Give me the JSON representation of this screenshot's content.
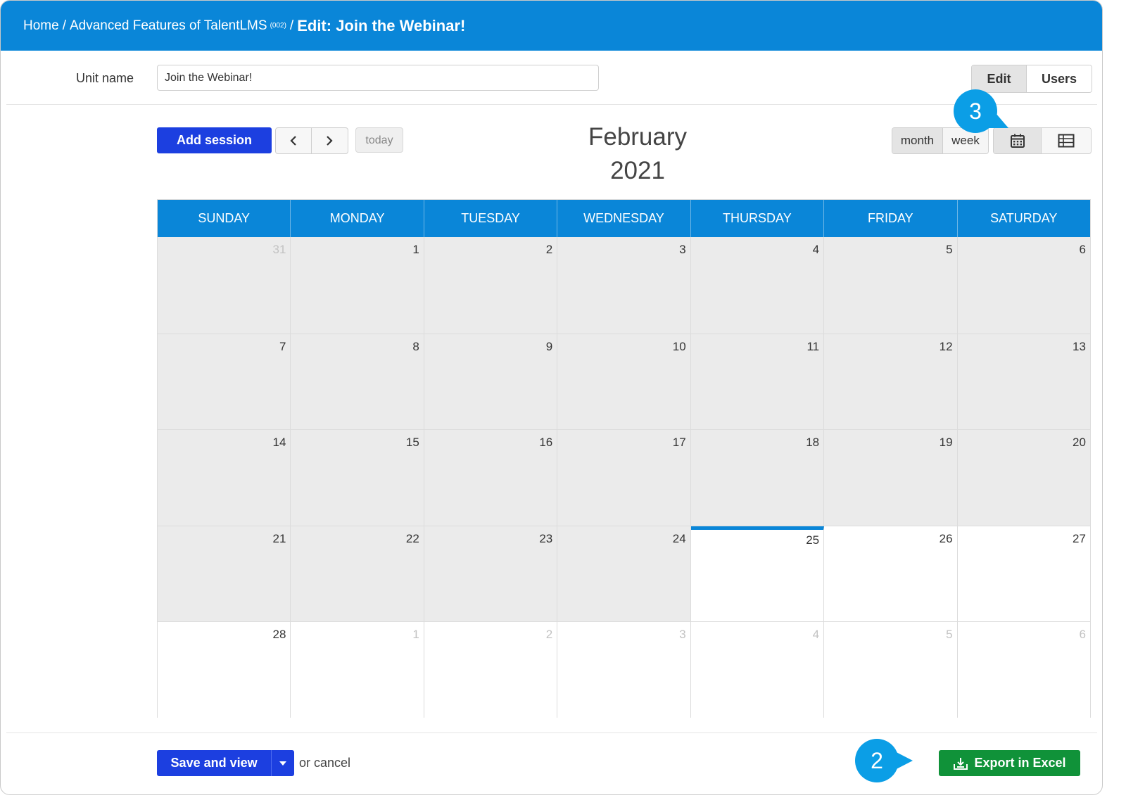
{
  "breadcrumb": {
    "home": "Home",
    "course": "Advanced Features of TalentLMS",
    "course_code": "(002)",
    "current": "Edit: Join the Webinar!"
  },
  "unit": {
    "label": "Unit name",
    "value": "Join the Webinar!"
  },
  "tabs": {
    "edit": "Edit",
    "users": "Users",
    "active": "Edit"
  },
  "toolbar": {
    "add_session": "Add session",
    "today": "today",
    "title_month": "February",
    "title_year": "2021",
    "view_month": "month",
    "view_week": "week",
    "active_view": "month",
    "calendar_view_icon": "calendar-icon",
    "list_view_icon": "table-icon"
  },
  "calendar": {
    "weekdays": [
      "SUNDAY",
      "MONDAY",
      "TUESDAY",
      "WEDNESDAY",
      "THURSDAY",
      "FRIDAY",
      "SATURDAY"
    ],
    "weeks": [
      [
        "31",
        "1",
        "2",
        "3",
        "4",
        "5",
        "6"
      ],
      [
        "7",
        "8",
        "9",
        "10",
        "11",
        "12",
        "13"
      ],
      [
        "14",
        "15",
        "16",
        "17",
        "18",
        "19",
        "20"
      ],
      [
        "21",
        "22",
        "23",
        "24",
        "25",
        "26",
        "27"
      ],
      [
        "28",
        "1",
        "2",
        "3",
        "4",
        "5",
        "6"
      ]
    ],
    "today": "25",
    "header_color": "#0a86d8"
  },
  "footer": {
    "save_and_view": "Save and view",
    "or_cancel": "or cancel",
    "export_excel": "Export in Excel"
  },
  "callouts": {
    "step_2": "2",
    "step_3": "3"
  },
  "colors": {
    "brand_blue": "#0a86d8",
    "button_blue": "#1c3fe0",
    "export_green": "#109239",
    "callout_blue": "#0b9ee6"
  }
}
